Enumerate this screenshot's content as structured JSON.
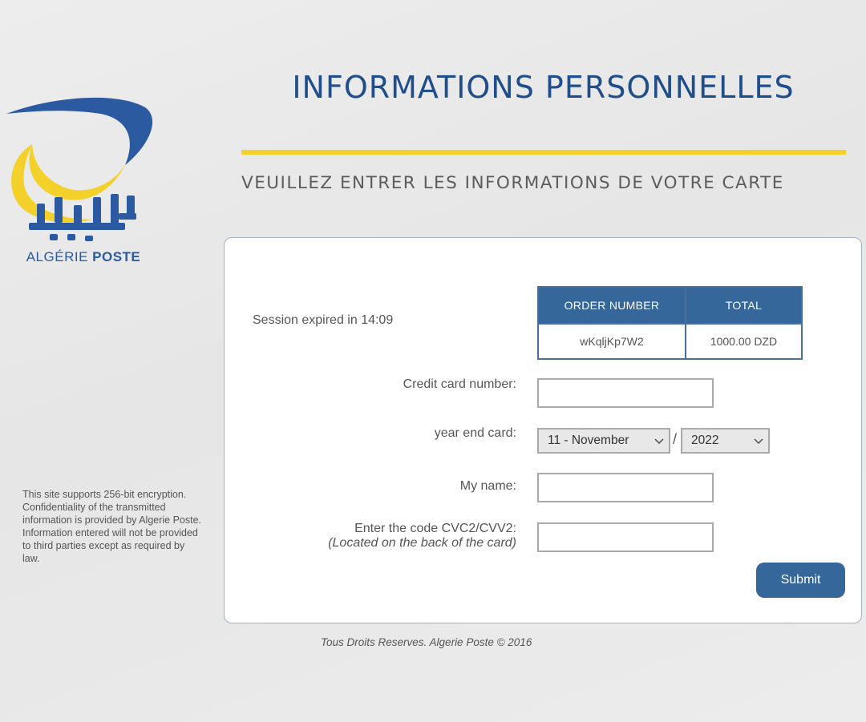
{
  "brand": {
    "logo_text_light": "ALGÉRIE ",
    "logo_text_bold": "POSTE",
    "colors": {
      "blue": "#2c5aa0",
      "yellow": "#f4d12a"
    }
  },
  "header": {
    "title": "INFORMATIONS PERSONNELLES",
    "subtitle": "VEUILLEZ ENTRER LES INFORMATIONS DE VOTRE CARTE"
  },
  "sidebar": {
    "encryption_note": "This site supports 256-bit encryption. Confidentiality of the transmitted information is provided by Algerie Poste. Information entered will not be provided to third parties except as required by law."
  },
  "session": {
    "text": "Session expired in 14:09"
  },
  "order": {
    "headers": {
      "order_number": "ORDER NUMBER",
      "total": "TOTAL"
    },
    "order_number": "wKqljKp7W2",
    "total": "1000.00 DZD"
  },
  "form": {
    "card_number": {
      "label": "Credit card number:",
      "value": "",
      "placeholder": ""
    },
    "expiry": {
      "label": "year end card:",
      "month_value": "11 - November",
      "separator": "/",
      "year_value": "2022"
    },
    "name": {
      "label": "My name:",
      "value": "",
      "placeholder": ""
    },
    "cvc": {
      "label": "Enter the code CVC2/CVV2:",
      "hint": "(Located on the back of the card)",
      "value": "",
      "placeholder": ""
    },
    "submit_label": "Submit"
  },
  "footer": {
    "text": "Tous Droits Reserves. Algerie Poste © 2016"
  },
  "icons": {
    "logo": "algerie-poste-logo",
    "dropdown": "chevron-down-icon"
  }
}
